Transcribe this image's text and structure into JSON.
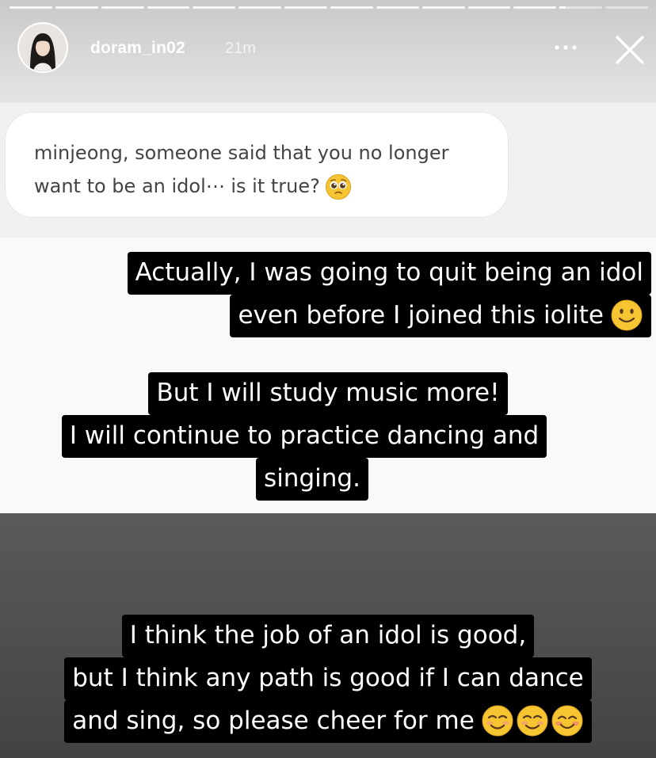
{
  "story": {
    "progress_segments": 14,
    "current_segment": 13,
    "current_progress": 0.15
  },
  "header": {
    "username": "doram_in02",
    "time": "21m",
    "more_icon": "more-horizontal-icon",
    "close_icon": "close-icon"
  },
  "question": {
    "text": "minjeong, someone said that you no longer want to be an idol⋯ is it true?",
    "emoji": "pleading-face-emoji"
  },
  "captions": {
    "block1": {
      "line1": "Actually, I was going to quit being an idol",
      "line2": "even before I joined this iolite",
      "emoji": "slightly-smiling-face-emoji"
    },
    "block2": {
      "line1": "But I will study music more!",
      "line2": "I will continue to practice dancing and",
      "line3": "singing."
    },
    "block3": {
      "line1": "I think the job of an idol is good,",
      "line2": "but I think any path is good if I can dance",
      "line3": "and sing, so please cheer for me",
      "emojis": [
        "relieved-smiling-face-emoji",
        "relieved-smiling-face-emoji",
        "smiling-face-with-smiling-eyes-emoji"
      ]
    }
  },
  "colors": {
    "caption_bg": "#000000",
    "caption_text": "#ffffff",
    "emoji_yellow": "#f7c531"
  }
}
